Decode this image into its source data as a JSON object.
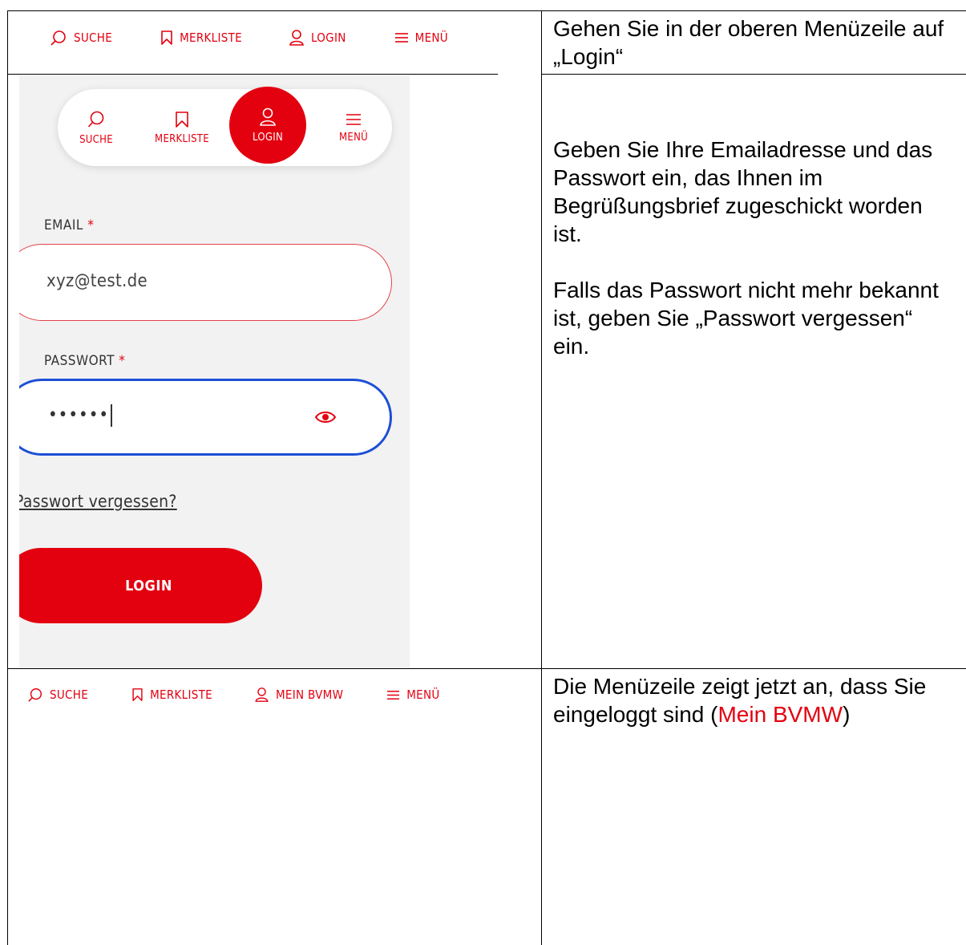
{
  "row1": {
    "menu": {
      "search": "SUCHE",
      "wishlist": "MERKLISTE",
      "login": "LOGIN",
      "menu": "MENÜ"
    },
    "instruction": "Gehen Sie in der oberen Menüzeile auf „Login“"
  },
  "row2": {
    "pill": {
      "search": "SUCHE",
      "wishlist": "MERKLISTE",
      "login": "LOGIN",
      "menu": "MENÜ"
    },
    "email_label": "EMAIL",
    "password_label": "PASSWORT",
    "required_mark": "*",
    "email_value": "xyz@test.de",
    "password_value": "••••••",
    "forgot_link": "Passwort vergessen?",
    "login_button": "LOGIN",
    "instruction_p1": "Geben Sie Ihre Emailadresse und das Passwort ein, das Ihnen im Begrüßungsbrief zugeschickt worden ist.",
    "instruction_p2": "Falls das Passwort nicht mehr bekannt ist, geben Sie „Passwort vergessen“ ein."
  },
  "row3": {
    "menu": {
      "search": "SUCHE",
      "wishlist": "MERKLISTE",
      "account": "MEIN BVMW",
      "menu": "MENÜ"
    },
    "instruction_pre": "Die Menüzeile zeigt jetzt an, dass Sie eingeloggt sind (",
    "instruction_highlight": "Mein BVMW",
    "instruction_post": ")"
  },
  "colors": {
    "brand_red": "#e3000f",
    "focus_blue": "#1d4fd6",
    "screen_bg": "#f2f2f2"
  }
}
